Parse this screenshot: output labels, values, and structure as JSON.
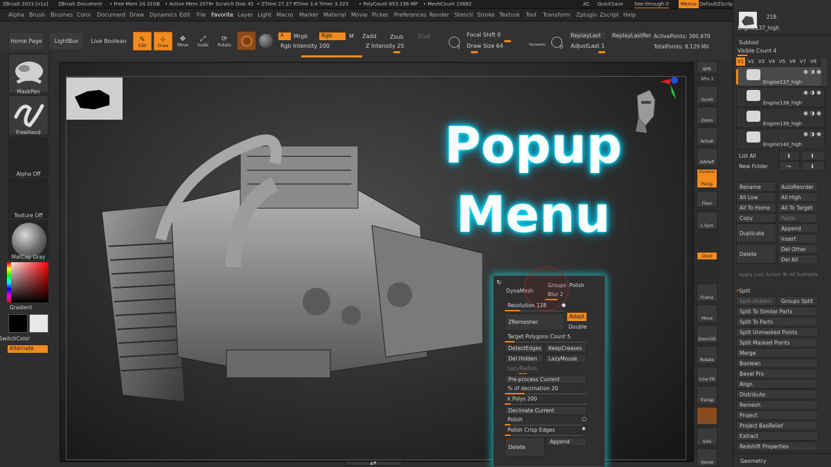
{
  "infobar": {
    "app": "ZBrush 2023 [n1z]",
    "doc": "ZBrush Document",
    "free_mem": "• Free Mem 24.31GB",
    "active_mem": "• Active Mem 2079",
    "scratch": "• Scratch Disk 45",
    "ztime": "• ZTime 27.27 RTime 3.4 Timer 3.323",
    "polycount": "• PolyCount 653.196 MP",
    "meshcount": "• MeshCount 10682",
    "ac": "AC",
    "quicksave": "QuickSave",
    "seethrough": "See-through  0",
    "menus": "Menus",
    "zscript": "DefaultZScript"
  },
  "menubar": [
    "Alpha",
    "Brush",
    "Brushes",
    "Color",
    "Document",
    "Draw",
    "Dynamics",
    "Edit",
    "File",
    "Favorite",
    "Layer",
    "Light",
    "Macro",
    "Marker",
    "Material",
    "Movie",
    "Picker",
    "Preferences",
    "Render",
    "Stencil",
    "Stroke",
    "Texture",
    "Tool",
    "Transform",
    "Zplugin",
    "Zscript",
    "Help"
  ],
  "menubar_active": "Favorite",
  "shelf": {
    "home": "Home Page",
    "lightbox": "LightBox",
    "liveboolean": "Live Boolean",
    "edit": "Edit",
    "draw": "Draw",
    "move": "Move",
    "scale": "Scale",
    "rotate": "Rotate",
    "a": "A",
    "mrgb": "Mrgb",
    "rgb": "Rgb",
    "m": "M",
    "zadd": "Zadd",
    "zsub": "Zsub",
    "zcut": "Zcut",
    "rgb_intensity": "Rgb Intensity 100",
    "z_intensity": "Z Intensity 25",
    "focal_shift": "Focal Shift 0",
    "draw_size": "Draw Size 64",
    "dynamic": "Dynamic",
    "s": "S",
    "d": "D",
    "replay_last": "ReplayLast",
    "replay_last_rel": "ReplayLastRel",
    "adjust_last": "AdjustLast 1",
    "active_points": "ActivePoints: 390,670",
    "total_points": "TotalPoints: 8.129 Mil"
  },
  "left": {
    "maskpen": "MaskPen",
    "freehand": "FreeHand",
    "alpha_off": "Alpha Off",
    "texture_off": "Texture Off",
    "matcap": "MatCap Gray",
    "gradient": "Gradient",
    "switchcolor": "SwitchColor",
    "alternate": "Alternate"
  },
  "right_shelf": [
    "BPR",
    "SPix 3",
    "Scroll",
    "Zoom",
    "Actual",
    "AAHalf",
    "Persp",
    "Floor",
    "L.Sym",
    "Qxyz",
    "Frame",
    "Move",
    "Zoom3D",
    "Rotate",
    "Line Fill",
    "PolyF",
    "Transp",
    "Ghost",
    "Solo",
    "Xpose"
  ],
  "right_shelf_labels": {
    "dynamic": "Dynamic",
    "persp": "Persp"
  },
  "tray": {
    "tool_count": "218",
    "tool_name": "Engine137_high",
    "subtool_header": "Subtool",
    "visible_count": "Visible Count 4",
    "vtabs": [
      "V1",
      "V2",
      "V3",
      "V4",
      "V5",
      "V6",
      "V7",
      "V8"
    ],
    "items": [
      "Engine137_high",
      "Engine138_high",
      "Engine139_high",
      "Engine140_high"
    ],
    "list_all": "List All",
    "new_folder": "New Folder",
    "rename": "Rename",
    "auto_reorder": "AutoReorder",
    "all_low": "All Low",
    "all_high": "All High",
    "all_to_home": "All To Home",
    "all_to_target": "All To Target",
    "copy": "Copy",
    "paste": "Paste",
    "duplicate": "Duplicate",
    "append": "Append",
    "insert": "Insert",
    "delete": "Delete",
    "del_other": "Del Other",
    "del_all": "Del All",
    "apply_last": "Apply Last Action To All Subtools",
    "split": "Split",
    "split_hidden": "Split Hidden",
    "groups_split": "Groups Split",
    "split_similar": "Split To Similar Parts",
    "split_parts": "Split To Parts",
    "split_unmasked": "Split Unmasked Points",
    "split_masked": "Split Masked Points",
    "merge": "Merge",
    "boolean": "Boolean",
    "bevel_pro": "Bevel Pro",
    "align": "Align",
    "distribute": "Distribute",
    "remesh": "Remesh",
    "project": "Project",
    "project_basrelief": "Project BasRelief",
    "extract": "Extract",
    "redshift": "Redshift Properties",
    "geometry": "Geometry"
  },
  "popup": {
    "dynamesh": "DynaMesh",
    "groups": "Groups",
    "polish": "Polish",
    "blur": "Blur 2",
    "resolution": "Resolution 128",
    "zremesher": "ZRemesher",
    "adapt": "Adapt",
    "double": "Double",
    "target_polys": "Target Polygons Count 5",
    "detect_edges": "DetectEdges",
    "keep_creases": "KeepCreases",
    "del_hidden": "Del Hidden",
    "lazy_mouse": "LazyMouse",
    "lazy_radius": "LazyRadius",
    "preprocess": "Pre-process Current",
    "pct_decimation": "% of decimation 20",
    "k_polys": "k Polys 200",
    "decimate": "Decimate Current",
    "polish2": "Polish",
    "polish_crisp": "Polish Crisp Edges",
    "delete": "Delete",
    "append": "Append"
  },
  "overlay_title": [
    "Popup",
    "Menu"
  ],
  "colors": {
    "accent": "#f28a1d",
    "glow": "#00e5ff",
    "bg": "#2e2e2e"
  }
}
